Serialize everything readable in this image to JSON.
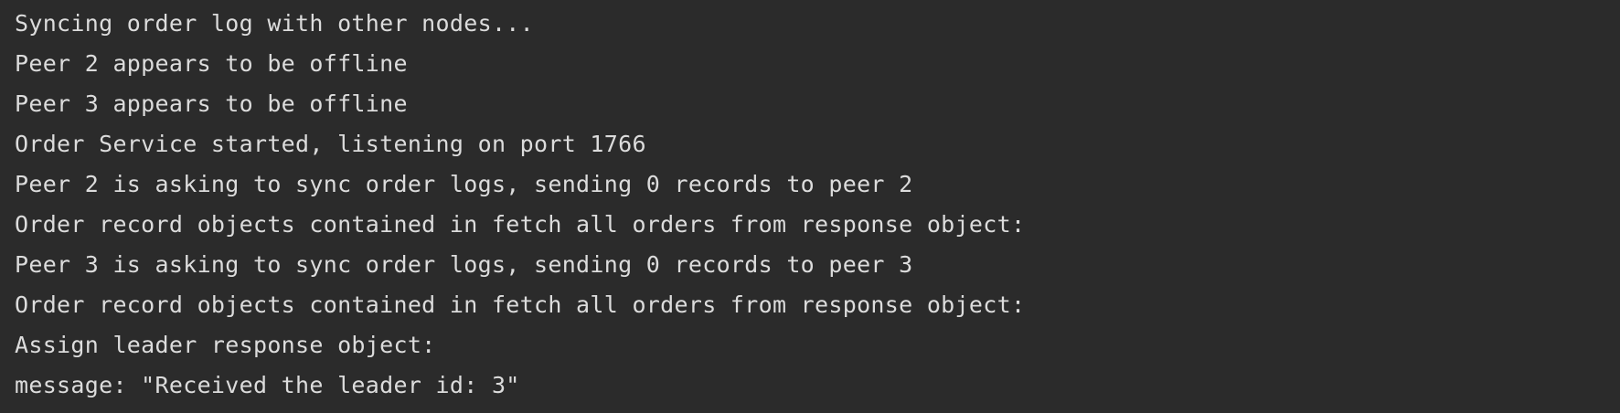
{
  "console": {
    "lines": [
      "Syncing order log with other nodes...",
      "Peer 2 appears to be offline",
      "Peer 3 appears to be offline",
      "Order Service started, listening on port 1766",
      "Peer 2 is asking to sync order logs, sending 0 records to peer 2",
      "Order record objects contained in fetch all orders from response object:",
      "Peer 3 is asking to sync order logs, sending 0 records to peer 3",
      "Order record objects contained in fetch all orders from response object:",
      "Assign leader response object:",
      "message: \"Received the leader id: 3\""
    ]
  }
}
